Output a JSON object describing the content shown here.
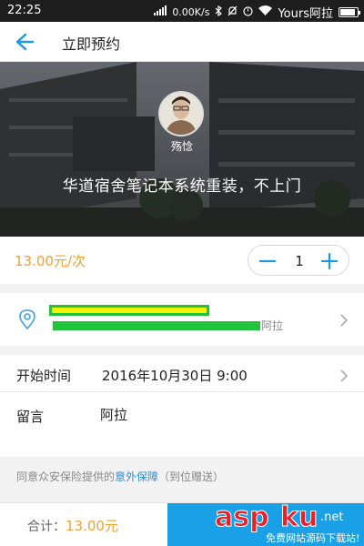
{
  "status_bar": {
    "time": "22:25",
    "net_speed": "0.00K/s",
    "carrier": "Yours阿拉",
    "battery_level": 0.9
  },
  "nav": {
    "title": "立即预约",
    "back_icon": "back-arrow-icon"
  },
  "hero": {
    "name": "殇惗",
    "title": "华道宿舍笔记本系统重装，不上门"
  },
  "price": {
    "text": "13.00元/次",
    "quantity": "1",
    "color": "#f0a030"
  },
  "address": {
    "tail": "阿拉",
    "icon": "location-pin-icon"
  },
  "form": {
    "time_label": "开始时间",
    "time_value": "2016年10月30日 9:00",
    "note_label": "留言",
    "note_value": "阿拉"
  },
  "insurance": {
    "prefix": "同意众安保险提供的",
    "link": "意外保障",
    "suffix": "（到位赠送）"
  },
  "footer": {
    "total_label": "合计：",
    "total_amount": "13.00元",
    "accent": "#1aa0e6"
  },
  "watermark": {
    "brand": "aspku",
    "tld": ".net",
    "tagline": "免费网站源码下载站!"
  }
}
